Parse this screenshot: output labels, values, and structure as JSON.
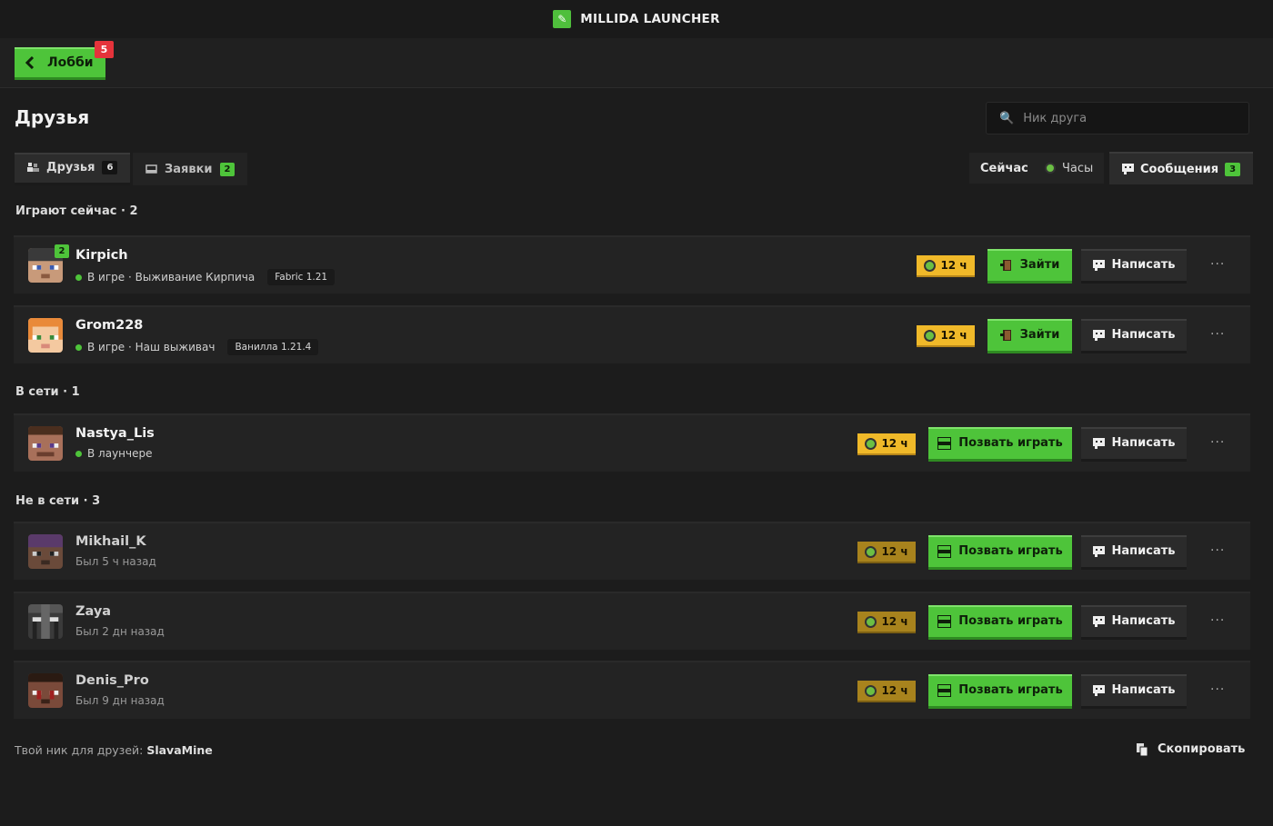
{
  "app": {
    "title": "MILLIDA LAUNCHER",
    "logo_glyph": "✎"
  },
  "topbar": {
    "lobby_label": "Лобби",
    "lobby_badge": "5"
  },
  "page": {
    "title": "Друзья"
  },
  "search": {
    "placeholder": "Ник друга",
    "value": ""
  },
  "tabs": [
    {
      "label": "Друзья",
      "count": "6",
      "icon": "users-icon"
    },
    {
      "label": "Заявки",
      "count": "2",
      "icon": "inbox-icon"
    }
  ],
  "filters": [
    {
      "label": "Сейчас"
    },
    {
      "label": "Часы",
      "icon": "clock-icon"
    },
    {
      "label": "Сообщения",
      "count": "3",
      "icon": "message-icon"
    }
  ],
  "sections": {
    "playing": "Играют сейчас · 2",
    "online": "В сети · 1",
    "offline": "Не в сети · 3"
  },
  "actions": {
    "join": "Зайти",
    "invite": "Позвать играть",
    "write": "Написать",
    "more": "···"
  },
  "friends": [
    {
      "nick": "Kirpich",
      "status": "В игре · Выживание Кирпича",
      "version": "Fabric 1.21",
      "hours": "12 ч",
      "badge": "2"
    },
    {
      "nick": "Grom228",
      "status": "В игре · Наш выживач",
      "version": "Ванилла 1.21.4",
      "hours": "12 ч"
    },
    {
      "nick": "Nastya_Lis",
      "status": "В лаунчере",
      "hours": "12 ч"
    },
    {
      "nick": "Mikhail_K",
      "status": "Был 5 ч назад",
      "hours": "12 ч"
    },
    {
      "nick": "Zaya",
      "status": "Был 2 дн назад",
      "hours": "12 ч"
    },
    {
      "nick": "Denis_Pro",
      "status": "Был 9 дн назад",
      "hours": "12 ч"
    }
  ],
  "footer": {
    "nick_label": "Твой ник для друзей:",
    "nick_value": "SlavaMine",
    "copy_label": "Скопировать"
  },
  "colors": {
    "accent": "#4ec43a",
    "hours": "#f0b929",
    "badge_red": "#e5333b"
  }
}
